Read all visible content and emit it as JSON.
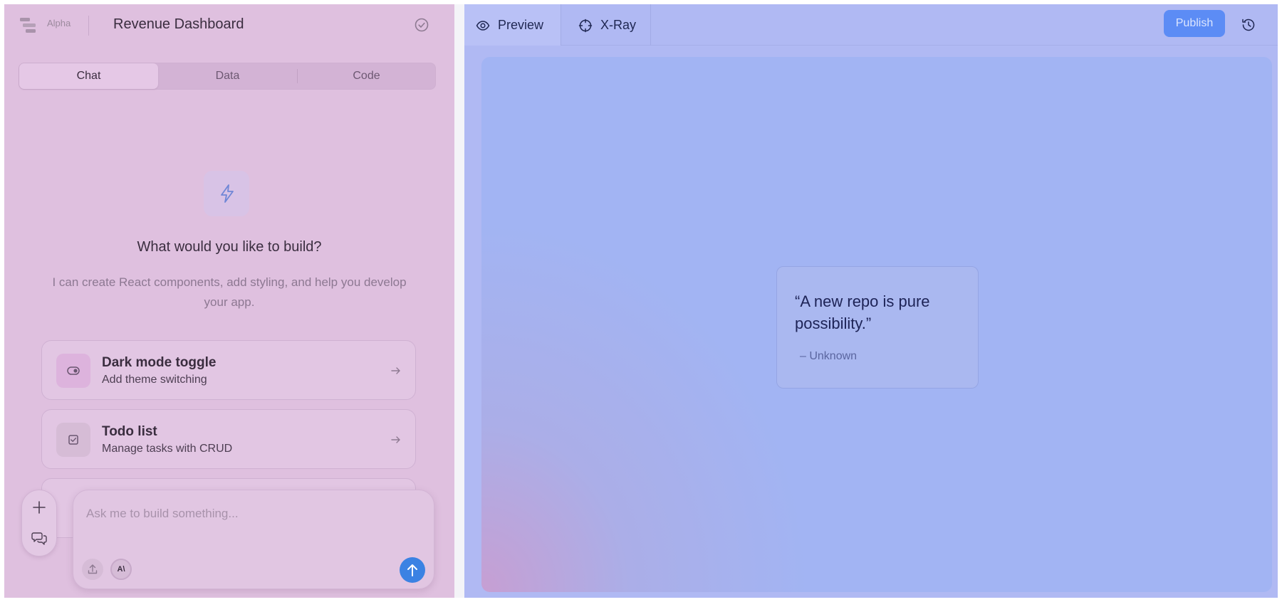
{
  "header": {
    "alpha_label": "Alpha",
    "project_title": "Revenue Dashboard"
  },
  "tabs": {
    "chat": "Chat",
    "data": "Data",
    "code": "Code",
    "active": "Chat"
  },
  "empty_state": {
    "title": "What would you like to build?",
    "subtitle": "I can create React components, add styling, and help you develop your app."
  },
  "suggestions": [
    {
      "title": "Dark mode toggle",
      "subtitle": "Add theme switching",
      "icon": "toggle-icon"
    },
    {
      "title": "Todo list",
      "subtitle": "Manage tasks with CRUD",
      "icon": "checkbox-icon"
    }
  ],
  "composer": {
    "placeholder": "Ask me to build something...",
    "value": "",
    "model_badge": "A\\"
  },
  "preview_header": {
    "tabs": [
      {
        "label": "Preview",
        "icon": "eye-icon"
      },
      {
        "label": "X-Ray",
        "icon": "crosshair-icon"
      }
    ],
    "active_tab": "Preview",
    "publish_label": "Publish"
  },
  "preview": {
    "quote": "“A new repo is pure possibility.”",
    "author": "– Unknown"
  },
  "colors": {
    "left_panel_bg": "#dfc0df",
    "right_panel_bg": "#b0b9f3",
    "accent_blue": "#3b82e3",
    "publish_blue": "#5c8cf5"
  }
}
